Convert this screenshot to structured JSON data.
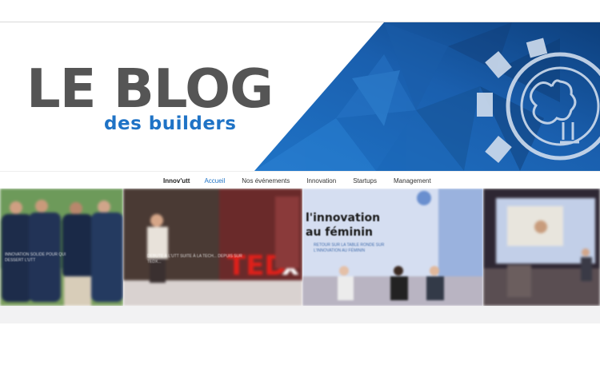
{
  "header": {
    "title": "LE BLOG",
    "subtitle": "des builders"
  },
  "nav": {
    "brand": "Innov'utt",
    "items": [
      "Accueil",
      "Nos événements",
      "Innovation",
      "Startups",
      "Management"
    ],
    "active": "Accueil"
  },
  "slides": [
    {
      "caption": "INNOVATION SOLIDE POUR QUI DESSERT L'UTT"
    },
    {
      "caption": "DEBUTE À L'UTT SUITE À LA TECH... DEPUIS SUR TEDX..."
    },
    {
      "heading": "l'innovation au féminin",
      "caption": "RETOUR SUR LA TABLE RONDE SUR L'INNOVATION AU FÉMININ"
    },
    {
      "caption": ""
    }
  ],
  "colors": {
    "accent": "#1f73c6",
    "title_gray": "#555555",
    "banner_blue_dark": "#0c3f7a",
    "banner_blue_light": "#2b7dd2"
  }
}
